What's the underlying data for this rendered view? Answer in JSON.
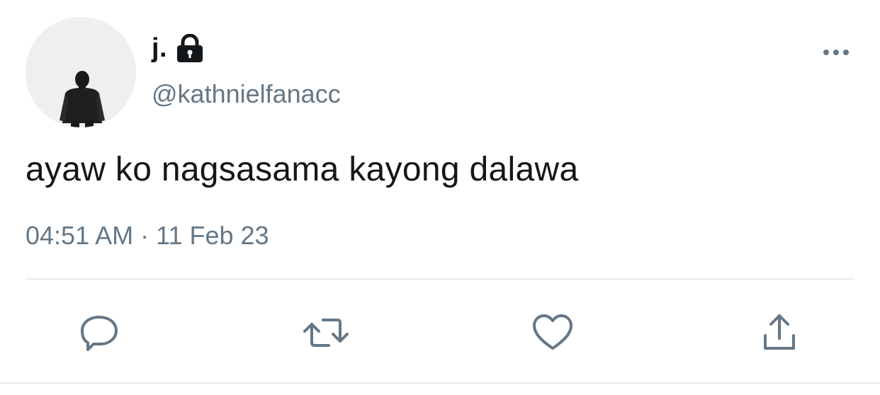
{
  "tweet": {
    "display_name": "j.",
    "handle": "@kathnielfanacc",
    "text": "ayaw ko nagsasama kayong dalawa",
    "timestamp": "04:51 AM · 11 Feb 23",
    "account_icon": "lock-icon",
    "more_icon": "more-icon"
  },
  "actions": {
    "reply_icon": "reply-icon",
    "retweet_icon": "retweet-icon",
    "like_icon": "heart-icon",
    "share_icon": "share-icon"
  },
  "colors": {
    "text_primary": "#14171a",
    "text_secondary": "#657786",
    "divider": "#e6ecf0",
    "avatar_bg": "#efefef"
  }
}
